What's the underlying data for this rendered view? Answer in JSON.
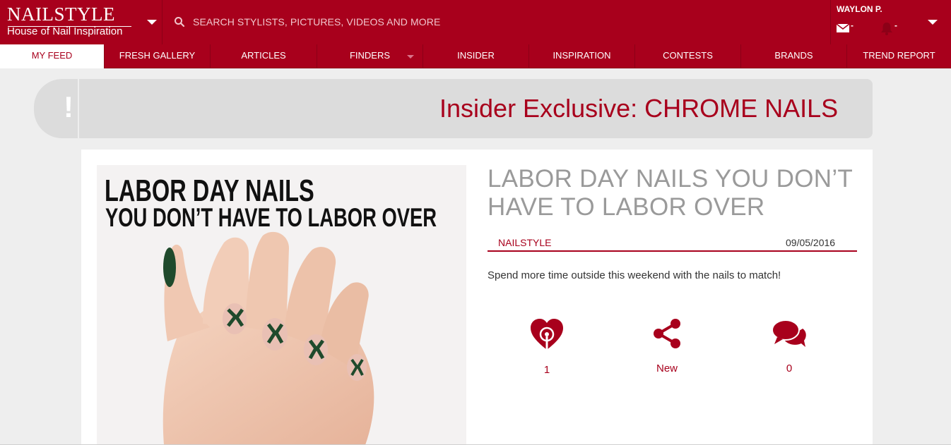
{
  "brand": {
    "logo_title": "NAILSTYLE",
    "logo_subtitle": "House of Nail Inspiration"
  },
  "search": {
    "placeholder": "SEARCH STYLISTS, PICTURES, VIDEOS AND MORE"
  },
  "user": {
    "name": "WAYLON P.",
    "messages_count": "-",
    "notifications_count": "-"
  },
  "nav": {
    "items": [
      {
        "label": "MY FEED",
        "active": true
      },
      {
        "label": "FRESH GALLERY"
      },
      {
        "label": "ARTICLES"
      },
      {
        "label": "FINDERS",
        "has_dropdown": true
      },
      {
        "label": "INSIDER"
      },
      {
        "label": "INSPIRATION"
      },
      {
        "label": "CONTESTS"
      },
      {
        "label": "BRANDS"
      },
      {
        "label": "TREND REPORT"
      }
    ]
  },
  "banner": {
    "icon": "!",
    "text": "Insider Exclusive: CHROME NAILS"
  },
  "article": {
    "image_heading_1": "LABOR DAY NAILS",
    "image_heading_2": "YOU DON’T HAVE TO LABOR OVER",
    "title": "LABOR DAY NAILS YOU DON’T HAVE TO LABOR OVER",
    "author": "NAILSTYLE",
    "date": "09/05/2016",
    "description": "Spend more time outside this weekend with the nails to match!",
    "stats": {
      "likes": "1",
      "shares": "New",
      "comments": "0"
    }
  },
  "colors": {
    "brand_red": "#a8001c",
    "banner_gray": "#dcdcdc",
    "title_gray": "#9a9a9a",
    "page_bg": "#eeeeee"
  },
  "icons": [
    "chevron-down-icon",
    "search-icon",
    "mail-icon",
    "bell-icon",
    "heart-like-icon",
    "share-icon",
    "comments-icon"
  ]
}
